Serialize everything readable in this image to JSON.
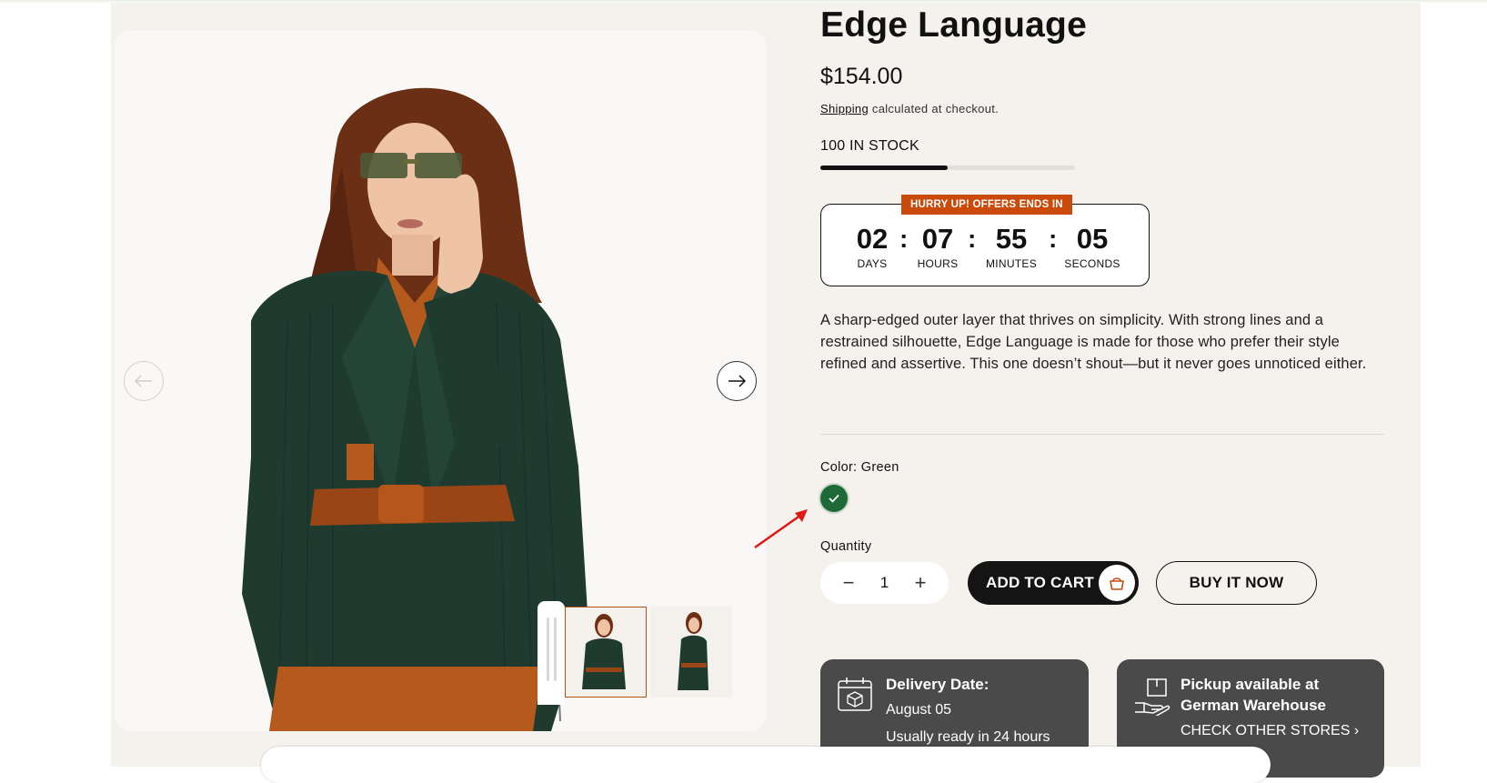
{
  "product": {
    "title": "Edge Language",
    "price": "$154.00",
    "shipping_link": "Shipping",
    "shipping_rest": " calculated at checkout.",
    "stock_text": "100 IN STOCK",
    "stock_level": 0.5,
    "description": "A sharp-edged outer layer that thrives on simplicity. With strong lines and a restrained silhouette, Edge Language is made for those who prefer their style refined and assertive. This one doesn’t shout—but it never goes unnoticed either."
  },
  "countdown": {
    "badge": "HURRY UP! OFFERS ENDS IN",
    "days": "02",
    "days_label": "DAYS",
    "hours": "07",
    "hours_label": "HOURS",
    "minutes": "55",
    "minutes_label": "MINUTES",
    "seconds": "05",
    "seconds_label": "SECONDS",
    "separator": ":"
  },
  "variant": {
    "color_label": "Color: Green",
    "swatch_color": "#1e6a36"
  },
  "quantity": {
    "label": "Quantity",
    "value": "1",
    "minus": "−",
    "plus": "+"
  },
  "actions": {
    "add_to_cart": "ADD TO CART",
    "buy_now": "BUY IT NOW"
  },
  "delivery": {
    "title": "Delivery Date:",
    "date": "August 05",
    "note": "Usually ready in 24 hours"
  },
  "pickup": {
    "title_line1": "Pickup available at",
    "title_line2": "German Warehouse",
    "link": "CHECK OTHER STORES",
    "chevron": "›"
  },
  "colors": {
    "accent": "#c94a0a",
    "dark": "#141414",
    "card": "#4a4a4a",
    "page_bg": "#f5f2ee"
  }
}
